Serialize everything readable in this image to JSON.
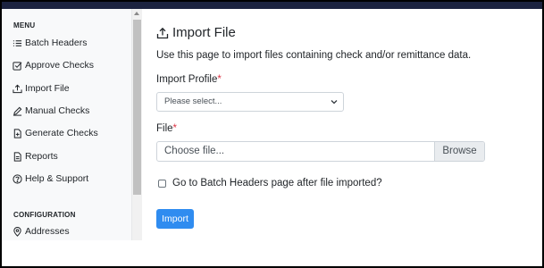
{
  "sidebar": {
    "menu_title": "MENU",
    "items": [
      {
        "label": "Batch Headers",
        "icon": "list-icon"
      },
      {
        "label": "Approve Checks",
        "icon": "check-square-icon"
      },
      {
        "label": "Import File",
        "icon": "upload-icon"
      },
      {
        "label": "Manual Checks",
        "icon": "pencil-icon"
      },
      {
        "label": "Generate Checks",
        "icon": "file-generate-icon"
      },
      {
        "label": "Reports",
        "icon": "report-icon"
      },
      {
        "label": "Help & Support",
        "icon": "question-circle-icon"
      }
    ],
    "config_title": "CONFIGURATION",
    "config_items": [
      {
        "label": "Addresses",
        "icon": "map-pin-icon"
      }
    ]
  },
  "page": {
    "title": "Import File",
    "title_icon": "upload-icon",
    "description": "Use this page to import files containing check and/or remittance data."
  },
  "form": {
    "profile_label": "Import Profile",
    "required_mark": "*",
    "profile_placeholder": "Please select...",
    "file_label": "File",
    "file_placeholder": "Choose file...",
    "browse_label": "Browse",
    "checkbox_label": "Go to Batch Headers page after file imported?",
    "checkbox_checked": false,
    "submit_label": "Import"
  },
  "colors": {
    "topbar": "#1c2340",
    "primary": "#2f8cf0",
    "required": "#dc3545"
  }
}
